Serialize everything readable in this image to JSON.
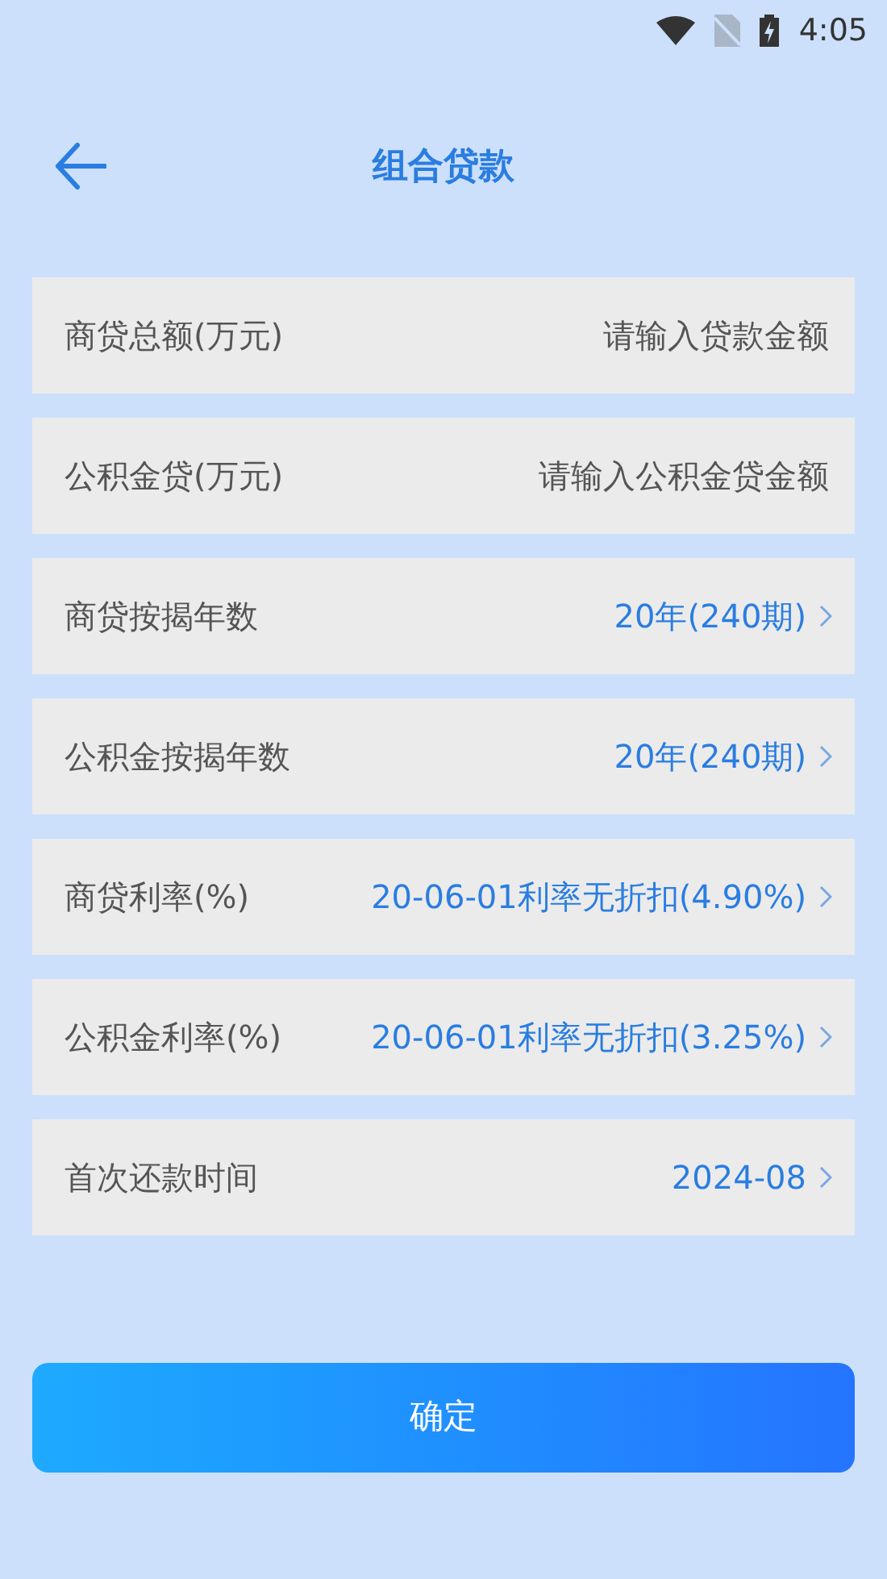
{
  "status_bar": {
    "time": "4:05"
  },
  "header": {
    "title": "组合贷款"
  },
  "rows": [
    {
      "kind": "input",
      "label": "商贷总额(万元)",
      "placeholder": "请输入贷款金额"
    },
    {
      "kind": "input",
      "label": "公积金贷(万元)",
      "placeholder": "请输入公积金贷金额"
    },
    {
      "kind": "select",
      "label": "商贷按揭年数",
      "value": "20年(240期)"
    },
    {
      "kind": "select",
      "label": "公积金按揭年数",
      "value": "20年(240期)"
    },
    {
      "kind": "select",
      "label": "商贷利率(%)",
      "value": "20-06-01利率无折扣(4.90%)"
    },
    {
      "kind": "select",
      "label": "公积金利率(%)",
      "value": "20-06-01利率无折扣(3.25%)"
    },
    {
      "kind": "select",
      "label": "首次还款时间",
      "value": "2024-08"
    }
  ],
  "confirm_button": "确定"
}
